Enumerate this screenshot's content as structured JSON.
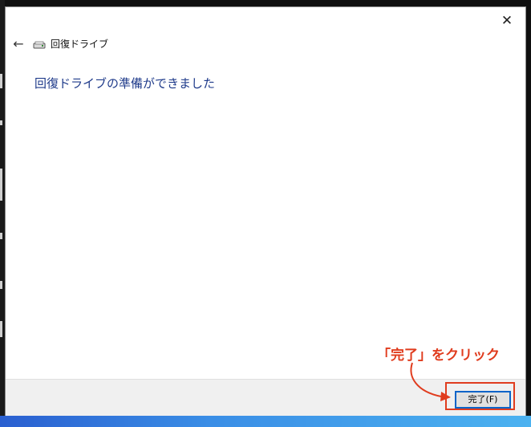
{
  "dialog": {
    "title": "回復ドライブ",
    "heading": "回復ドライブの準備ができました",
    "close_glyph": "✕",
    "back_glyph": "←",
    "finish_label": "完了(F)"
  },
  "annotation": {
    "callout_text": "「完了」をクリック",
    "color": "#e03c1e"
  },
  "colors": {
    "heading": "#1e3a8a",
    "accent": "#0a64c8"
  },
  "icons": [
    "close-icon",
    "back-arrow-icon",
    "drive-icon"
  ]
}
